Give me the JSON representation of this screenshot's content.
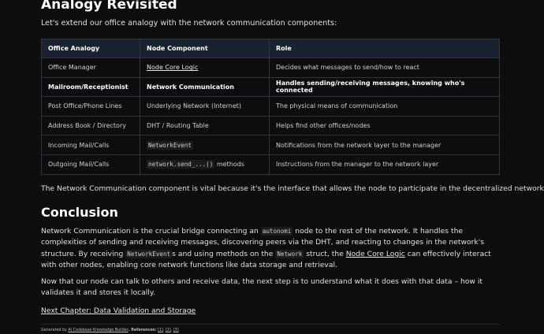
{
  "analogy": {
    "title": "Analogy Revisited",
    "intro": "Let's extend our office analogy with the network communication components:"
  },
  "table": {
    "headers": [
      "Office Analogy",
      "Node Component",
      "Role"
    ],
    "rows": [
      [
        "Office Manager",
        "Node Core Logic",
        "Decides what messages to send/how to react"
      ],
      [
        "Mailroom/Receptionist",
        "Network Communication",
        "Handles sending/receiving messages, knowing who's connected"
      ],
      [
        "Post Office/Phone Lines",
        "Underlying Network (Internet)",
        "The physical means of communication"
      ],
      [
        "Address Book / Directory",
        "DHT / Routing Table",
        "Helps find other offices/nodes"
      ],
      [
        "Incoming Mail/Calls",
        "NetworkEvent",
        "Notifications from the network layer to the manager"
      ],
      [
        "Outgoing Mail/Calls",
        "network.send_...()",
        "Instructions from the manager to the network layer"
      ]
    ],
    "row6_suffix": " methods"
  },
  "vital": "The Network Communication component is vital because it's the interface that allows the node to participate in the decentralized network.",
  "conclusion": {
    "title": "Conclusion",
    "p1_a": "Network Communication is the crucial bridge connecting an ",
    "p1_code1": "autonomi",
    "p1_b": " node to the rest of the network. It handles the complexities of sending and receiving messages, discovering peers via the DHT, and reacting to changes in the network's structure. By receiving ",
    "p1_code2": "NetworkEvent",
    "p1_c": "s and using methods on the ",
    "p1_code3": "Network",
    "p1_d": " struct, the ",
    "p1_link": "Node Core Logic",
    "p1_e": " can effectively interact with other nodes, enabling core network functions like data storage and retrieval.",
    "p2": "Now that our node can talk to others and receive data, the next step is to understand what it does with that data – how it validates it and stores it locally.",
    "next_link": "Next Chapter: Data Validation and Storage"
  },
  "footer": {
    "generated": "Generated by ",
    "builder": "AI Codebase Knowledge Builder",
    "references_label": ". References: ",
    "refs": [
      "[1]",
      "[2]",
      "[3]"
    ]
  }
}
